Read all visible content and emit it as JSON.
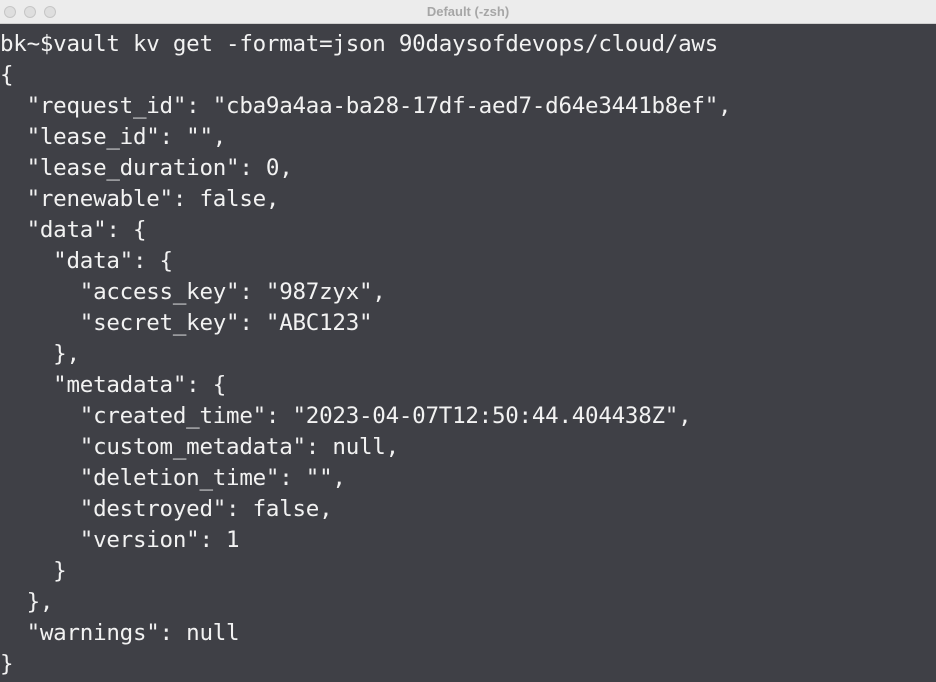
{
  "window": {
    "title": "Default (-zsh)"
  },
  "terminal": {
    "lines": [
      "bk~$vault kv get -format=json 90daysofdevops/cloud/aws",
      "{",
      "  \"request_id\": \"cba9a4aa-ba28-17df-aed7-d64e3441b8ef\",",
      "  \"lease_id\": \"\",",
      "  \"lease_duration\": 0,",
      "  \"renewable\": false,",
      "  \"data\": {",
      "    \"data\": {",
      "      \"access_key\": \"987zyx\",",
      "      \"secret_key\": \"ABC123\"",
      "    },",
      "    \"metadata\": {",
      "      \"created_time\": \"2023-04-07T12:50:44.404438Z\",",
      "      \"custom_metadata\": null,",
      "      \"deletion_time\": \"\",",
      "      \"destroyed\": false,",
      "      \"version\": 1",
      "    }",
      "  },",
      "  \"warnings\": null",
      "}"
    ]
  }
}
